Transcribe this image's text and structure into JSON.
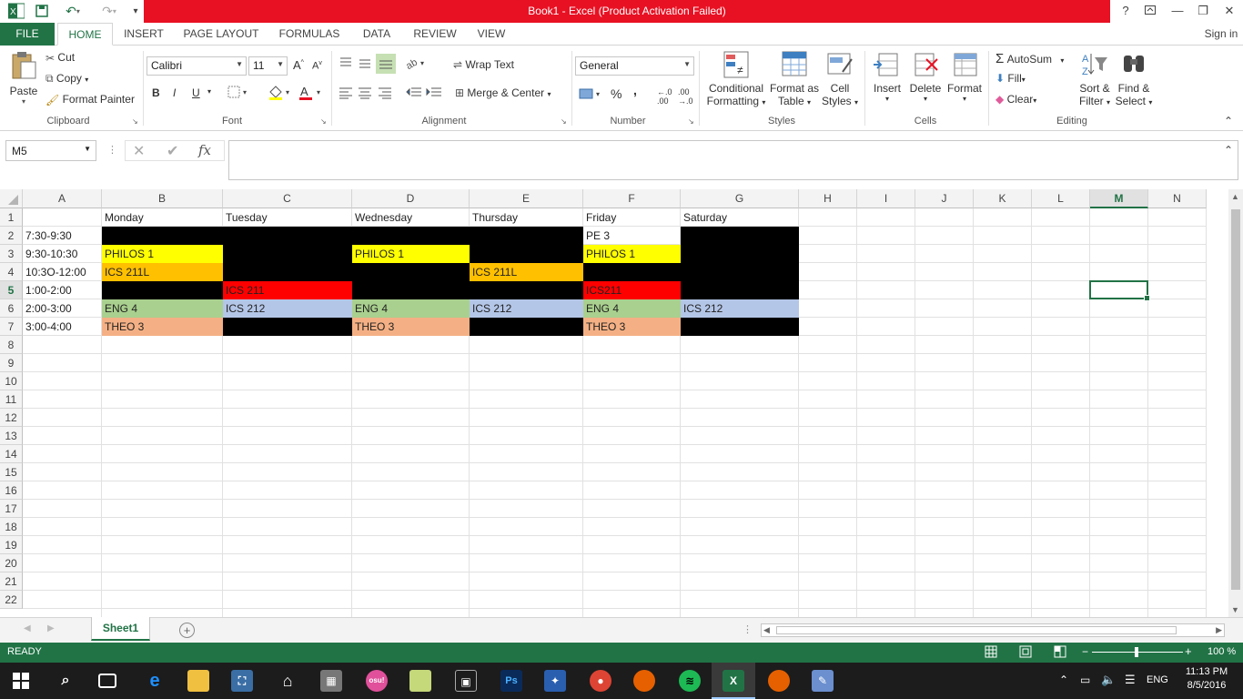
{
  "window": {
    "title": "Book1 -  Excel (Product Activation Failed)",
    "help": "?",
    "accent": "#217346",
    "activation_bar_color": "#e81123"
  },
  "tabs": [
    "FILE",
    "HOME",
    "INSERT",
    "PAGE LAYOUT",
    "FORMULAS",
    "DATA",
    "REVIEW",
    "VIEW"
  ],
  "active_tab": "HOME",
  "signin": "Sign in",
  "ribbon": {
    "clipboard": {
      "label": "Clipboard",
      "paste": "Paste",
      "cut": "Cut",
      "copy": "Copy",
      "format_painter": "Format Painter"
    },
    "font": {
      "label": "Font",
      "font_name": "Calibri",
      "font_size": "11",
      "bold": "B",
      "italic": "I",
      "underline": "U"
    },
    "alignment": {
      "label": "Alignment",
      "wrap_text": "Wrap Text",
      "merge_center": "Merge & Center"
    },
    "number": {
      "label": "Number",
      "format": "General",
      "percent": "%",
      "comma": ","
    },
    "styles": {
      "label": "Styles",
      "conditional": [
        "Conditional",
        "Formatting"
      ],
      "format_as_table": [
        "Format as",
        "Table"
      ],
      "cell_styles": [
        "Cell",
        "Styles"
      ]
    },
    "cells": {
      "label": "Cells",
      "insert": "Insert",
      "delete": "Delete",
      "format": "Format"
    },
    "editing": {
      "label": "Editing",
      "autosum": "AutoSum",
      "fill": "Fill",
      "clear": "Clear",
      "sort_filter": [
        "Sort &",
        "Filter"
      ],
      "find_select": [
        "Find &",
        "Select"
      ]
    }
  },
  "formula_bar": {
    "name_box": "M5",
    "fx": "fx",
    "value": ""
  },
  "columns": [
    "A",
    "B",
    "C",
    "D",
    "E",
    "F",
    "G",
    "H",
    "I",
    "J",
    "K",
    "L",
    "M",
    "N"
  ],
  "selected_column": "M",
  "selected_row": 5,
  "rows": [
    "1",
    "2",
    "3",
    "4",
    "5",
    "6",
    "7",
    "8",
    "9",
    "10",
    "11",
    "12",
    "13",
    "14",
    "15",
    "16",
    "17",
    "18",
    "19",
    "20",
    "21",
    "22"
  ],
  "cells": [
    {
      "ref": "B1",
      "text": "Monday"
    },
    {
      "ref": "C1",
      "text": "Tuesday"
    },
    {
      "ref": "D1",
      "text": "Wednesday"
    },
    {
      "ref": "E1",
      "text": "Thursday"
    },
    {
      "ref": "F1",
      "text": "Friday"
    },
    {
      "ref": "G1",
      "text": "Saturday"
    },
    {
      "ref": "A2",
      "text": "7:30-9:30"
    },
    {
      "ref": "B2",
      "text": "",
      "fill": "#000000"
    },
    {
      "ref": "C2",
      "text": "",
      "fill": "#000000"
    },
    {
      "ref": "D2",
      "text": "",
      "fill": "#000000"
    },
    {
      "ref": "E2",
      "text": "",
      "fill": "#000000"
    },
    {
      "ref": "F2",
      "text": "PE 3"
    },
    {
      "ref": "G2",
      "text": "",
      "fill": "#000000"
    },
    {
      "ref": "A3",
      "text": "9:30-10:30"
    },
    {
      "ref": "B3",
      "text": "PHILOS 1",
      "fill": "#ffff00"
    },
    {
      "ref": "C3",
      "text": "",
      "fill": "#000000"
    },
    {
      "ref": "D3",
      "text": "PHILOS 1",
      "fill": "#ffff00"
    },
    {
      "ref": "E3",
      "text": "",
      "fill": "#000000"
    },
    {
      "ref": "F3",
      "text": "PHILOS 1",
      "fill": "#ffff00"
    },
    {
      "ref": "G3",
      "text": "",
      "fill": "#000000"
    },
    {
      "ref": "A4",
      "text": "10:3O-12:00"
    },
    {
      "ref": "B4",
      "text": "ICS 211L",
      "fill": "#ffc000"
    },
    {
      "ref": "C4",
      "text": "",
      "fill": "#000000"
    },
    {
      "ref": "D4",
      "text": "",
      "fill": "#000000"
    },
    {
      "ref": "E4",
      "text": "ICS 211L",
      "fill": "#ffc000"
    },
    {
      "ref": "F4",
      "text": "",
      "fill": "#000000"
    },
    {
      "ref": "G4",
      "text": "",
      "fill": "#000000"
    },
    {
      "ref": "A5",
      "text": "1:00-2:00"
    },
    {
      "ref": "B5",
      "text": "",
      "fill": "#000000"
    },
    {
      "ref": "C5",
      "text": "ICS 211",
      "fill": "#ff0000"
    },
    {
      "ref": "D5",
      "text": "",
      "fill": "#000000"
    },
    {
      "ref": "E5",
      "text": "",
      "fill": "#000000"
    },
    {
      "ref": "F5",
      "text": "ICS211",
      "fill": "#ff0000"
    },
    {
      "ref": "G5",
      "text": "",
      "fill": "#000000"
    },
    {
      "ref": "A6",
      "text": "2:00-3:00"
    },
    {
      "ref": "B6",
      "text": "ENG 4",
      "fill": "#a9d08e"
    },
    {
      "ref": "C6",
      "text": "ICS 212",
      "fill": "#b4c6e7"
    },
    {
      "ref": "D6",
      "text": "ENG 4",
      "fill": "#a9d08e"
    },
    {
      "ref": "E6",
      "text": "ICS 212",
      "fill": "#b4c6e7"
    },
    {
      "ref": "F6",
      "text": "ENG 4",
      "fill": "#a9d08e"
    },
    {
      "ref": "G6",
      "text": "ICS 212",
      "fill": "#b4c6e7"
    },
    {
      "ref": "A7",
      "text": "3:00-4:00"
    },
    {
      "ref": "B7",
      "text": "THEO 3",
      "fill": "#f4b084"
    },
    {
      "ref": "C7",
      "text": "",
      "fill": "#000000"
    },
    {
      "ref": "D7",
      "text": "THEO 3",
      "fill": "#f4b084"
    },
    {
      "ref": "E7",
      "text": "",
      "fill": "#000000"
    },
    {
      "ref": "F7",
      "text": "THEO 3",
      "fill": "#f4b084"
    },
    {
      "ref": "G7",
      "text": "",
      "fill": "#000000"
    }
  ],
  "sheet_tabs": [
    "Sheet1"
  ],
  "status": {
    "mode": "READY",
    "zoom": "100 %"
  },
  "taskbar": {
    "time": "11:13 PM",
    "date": "8/5/2016",
    "lang": "ENG"
  }
}
